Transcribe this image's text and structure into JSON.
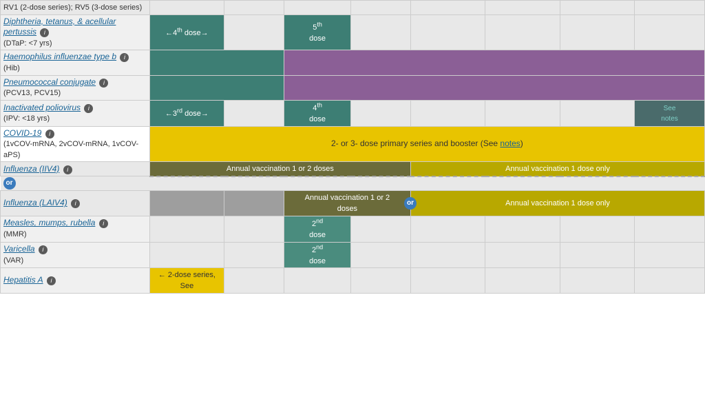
{
  "table": {
    "rows": [
      {
        "id": "rv",
        "nameLink": null,
        "name": "RV1 (2-dose series); RV5 (3-dose series)",
        "nameStyle": "plain",
        "cells": []
      },
      {
        "id": "dtap",
        "nameLink": "Diphtheria, tetanus, & acellular pertussis",
        "nameSub": "(DTaP: <7 yrs)",
        "info": true,
        "cells": [
          {
            "span": 1,
            "color": "teal",
            "text": "←4th dose→",
            "textColor": "white"
          },
          {
            "span": 1,
            "color": "empty"
          },
          {
            "span": 1,
            "color": "teal",
            "text": "5th\ndose",
            "textColor": "white"
          },
          {
            "span": 1,
            "color": "empty"
          },
          {
            "span": 1,
            "color": "empty"
          },
          {
            "span": 1,
            "color": "empty"
          },
          {
            "span": 1,
            "color": "empty"
          },
          {
            "span": 1,
            "color": "empty"
          }
        ]
      },
      {
        "id": "hib",
        "nameLink": "Haemophilus influenzae type b",
        "nameSub": "(Hib)",
        "info": true,
        "cells": [
          {
            "span": 2,
            "color": "teal"
          },
          {
            "span": 6,
            "color": "purple"
          }
        ]
      },
      {
        "id": "pcv",
        "nameLink": "Pneumococcal conjugate",
        "nameSub": "(PCV13, PCV15)",
        "info": true,
        "cells": [
          {
            "span": 2,
            "color": "teal"
          },
          {
            "span": 6,
            "color": "purple"
          }
        ]
      },
      {
        "id": "ipv",
        "nameLink": "Inactivated poliovirus",
        "nameSub": "(IPV: <18 yrs)",
        "info": true,
        "cells": [
          {
            "span": 1,
            "color": "teal",
            "text": "←3rd dose→",
            "textColor": "white"
          },
          {
            "span": 1,
            "color": "empty"
          },
          {
            "span": 1,
            "color": "teal",
            "text": "4th\ndose",
            "textColor": "white"
          },
          {
            "span": 1,
            "color": "empty"
          },
          {
            "span": 1,
            "color": "empty"
          },
          {
            "span": 1,
            "color": "empty"
          },
          {
            "span": 1,
            "color": "empty"
          },
          {
            "span": 1,
            "color": "dark-gray-cell",
            "text": "See\nnotes"
          }
        ]
      },
      {
        "id": "covid",
        "nameLink": "COVID-19",
        "nameSub": "(1vCOV-mRNA, 2vCOV-mRNA, 1vCOV-aPS)",
        "info": true,
        "isCovid": true,
        "cells": [
          {
            "span": 8,
            "color": "gold",
            "text": "2- or 3- dose primary series and booster (See notes)",
            "textColor": "dark"
          }
        ]
      },
      {
        "id": "influenza-iiv4",
        "nameLink": "Influenza (IIV4)",
        "info": true,
        "cells": [
          {
            "span": 4,
            "color": "influenza-dark",
            "text": "Annual vaccination 1 or 2 doses",
            "textColor": "white"
          },
          {
            "span": 4,
            "color": "influenza-gold",
            "text": "Annual vaccination 1 dose only",
            "textColor": "white"
          }
        ]
      },
      {
        "id": "influenza-laiv4",
        "nameLink": "Influenza (LAIV4)",
        "info": true,
        "isDashed": true,
        "hasOr": true,
        "cells": [
          {
            "span": 1,
            "color": "gray-cell"
          },
          {
            "span": 1,
            "color": "gray-cell"
          },
          {
            "span": 2,
            "color": "influenza-dark",
            "text": "Annual vaccination 1 or 2 doses",
            "textColor": "white",
            "hasOrMid": true
          },
          {
            "span": 4,
            "color": "influenza-gold",
            "text": "Annual vaccination 1 dose only",
            "textColor": "white"
          }
        ]
      },
      {
        "id": "mmr",
        "nameLink": "Measles, mumps, rubella",
        "nameSub": "(MMR)",
        "info": true,
        "cells": [
          {
            "span": 1,
            "color": "empty"
          },
          {
            "span": 1,
            "color": "empty"
          },
          {
            "span": 1,
            "color": "teal-medium",
            "text": "2nd\ndose",
            "textColor": "white"
          },
          {
            "span": 1,
            "color": "empty"
          },
          {
            "span": 1,
            "color": "empty"
          },
          {
            "span": 1,
            "color": "empty"
          },
          {
            "span": 1,
            "color": "empty"
          },
          {
            "span": 1,
            "color": "empty"
          }
        ]
      },
      {
        "id": "varicella",
        "nameLink": "Varicella",
        "nameSub": "(VAR)",
        "info": true,
        "cells": [
          {
            "span": 1,
            "color": "empty"
          },
          {
            "span": 1,
            "color": "empty"
          },
          {
            "span": 1,
            "color": "teal-medium",
            "text": "2nd\ndose",
            "textColor": "white"
          },
          {
            "span": 1,
            "color": "empty"
          },
          {
            "span": 1,
            "color": "empty"
          },
          {
            "span": 1,
            "color": "empty"
          },
          {
            "span": 1,
            "color": "empty"
          },
          {
            "span": 1,
            "color": "empty"
          }
        ]
      },
      {
        "id": "hepatitis-a",
        "nameLink": "Hepatitis A",
        "info": true,
        "cells": [
          {
            "span": 1,
            "color": "gold",
            "text": "← 2-dose series, See",
            "textColor": "dark"
          },
          {
            "span": 7,
            "color": "empty"
          }
        ]
      }
    ],
    "colors": {
      "teal": "#3d7e74",
      "purple": "#8b5f96",
      "gold": "#e8c400",
      "dark-gray-cell": "#5a6a6a",
      "gray-cell": "#9e9e9e",
      "influenza-dark": "#6b6b3a",
      "influenza-gold": "#b8a800",
      "teal-medium": "#4a8c7e",
      "empty": "#e8e8e8"
    }
  }
}
